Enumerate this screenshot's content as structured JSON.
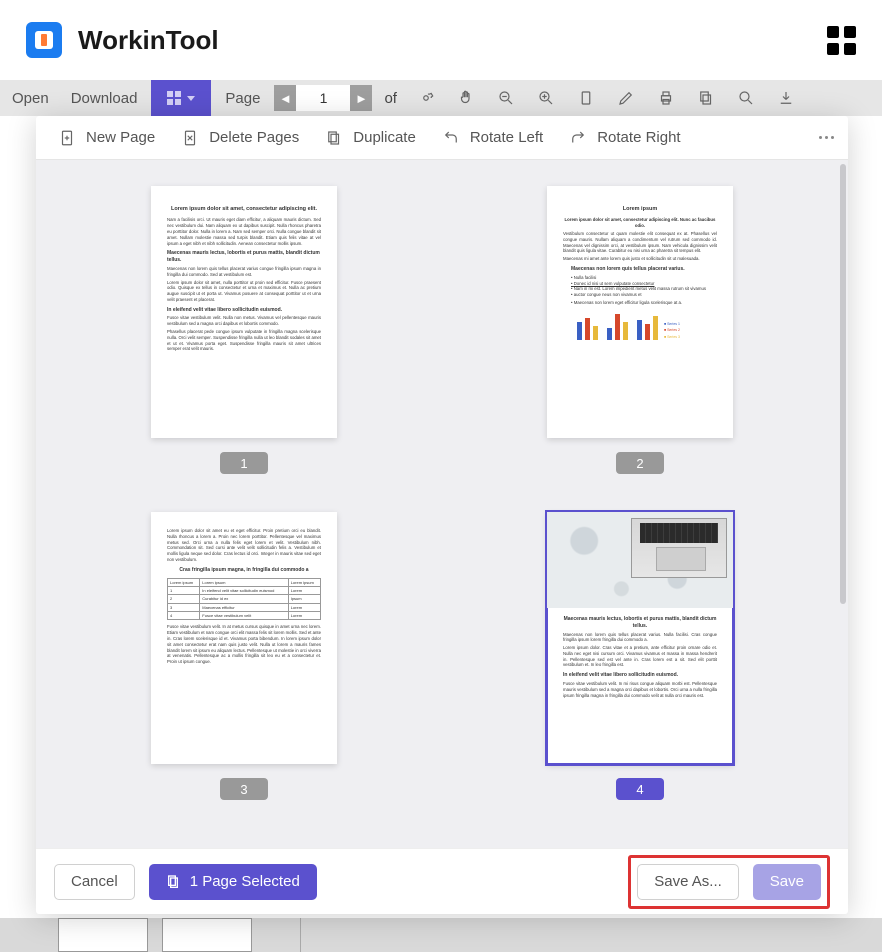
{
  "header": {
    "product_name": "WorkinTool"
  },
  "toolbar": {
    "open": "Open",
    "download": "Download",
    "page_lbl": "Page",
    "page_value": "1",
    "of": "of"
  },
  "modal": {
    "new_page": "New Page",
    "delete_pages": "Delete Pages",
    "duplicate": "Duplicate",
    "rotate_left": "Rotate Left",
    "rotate_right": "Rotate Right"
  },
  "pages": {
    "p1": "1",
    "p2": "2",
    "p3": "3",
    "p4": "4",
    "doc1": {
      "title": "Lorem ipsum dolor sit amet, consectetur adipiscing elit.",
      "h1": "Maecenas mauris lectus, lobortis et purus mattis, blandit dictum tellus.",
      "h2": "In eleifend velit vitae libero sollicitudin euismod."
    },
    "doc2": {
      "title": "Lorem ipsum",
      "sub": "Lorem ipsum dolor sit amet, consectetur adipiscing elit. Nunc ac faucibus odio.",
      "bheader": "Maecenas non lorem quis tellus placerat varius."
    },
    "doc3": {
      "h1": "Cras fringilla ipsum magna, in fringilla dui commodo a",
      "cells": {
        "r1c1": "Lorem ipsum",
        "r1c2": "Lorem ipsum",
        "r1c3": "Lorem ipsum",
        "r2c1": "1",
        "r2c2": "In eleifend velit vitae sollicitudin euismod",
        "r2c3": "Lorem",
        "r3c1": "2",
        "r3c2": "Curabitur id ex",
        "r3c3": "Ipsum",
        "r4c1": "3",
        "r4c2": "Maecenas efficitur",
        "r4c3": "Lorem",
        "r5c1": "4",
        "r5c2": "Fusce vitae vestibulum velit",
        "r5c3": "Lorem"
      }
    },
    "doc4": {
      "h1": "Maecenas mauris lectus, lobortis et purus mattis, blandit dictum tellus.",
      "h2": "In eleifend velit vitae libero sollicitudin euismod."
    }
  },
  "footer": {
    "cancel": "Cancel",
    "selected": "1 Page Selected",
    "save_as": "Save As...",
    "save": "Save"
  }
}
